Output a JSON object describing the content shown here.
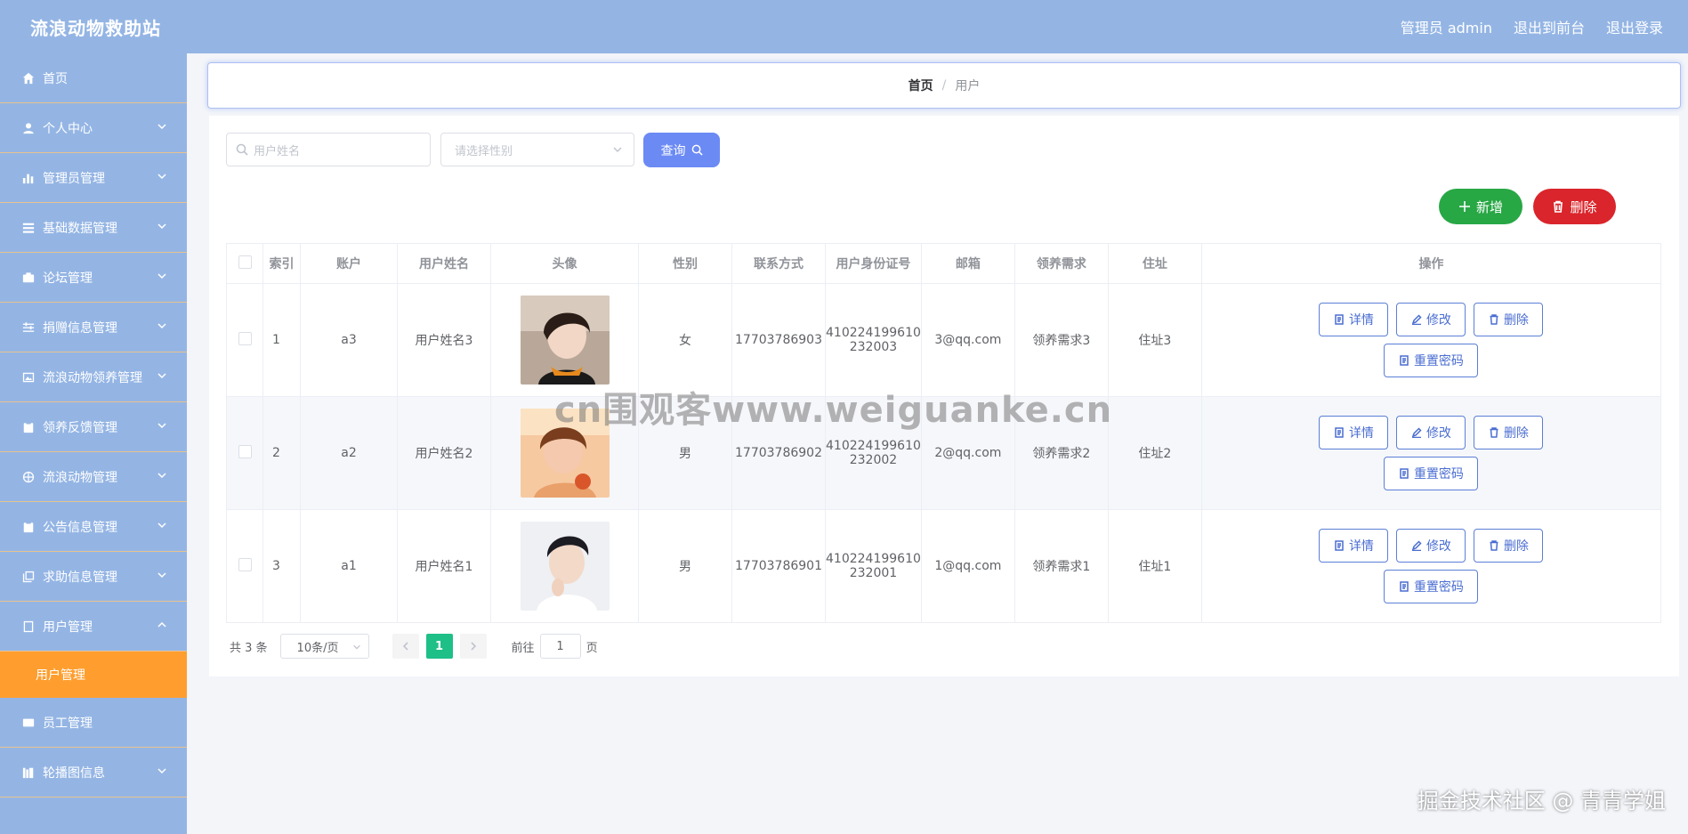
{
  "header": {
    "brand": "流浪动物救助站",
    "admin_label": "管理员 admin",
    "front_label": "退出到前台",
    "logout_label": "退出登录"
  },
  "sidebar": {
    "items": [
      {
        "label": "首页",
        "icon": "home-icon",
        "has_chevron": false
      },
      {
        "label": "个人中心",
        "icon": "user-icon",
        "has_chevron": true
      },
      {
        "label": "管理员管理",
        "icon": "bar-chart-icon",
        "has_chevron": true
      },
      {
        "label": "基础数据管理",
        "icon": "list-icon",
        "has_chevron": true
      },
      {
        "label": "论坛管理",
        "icon": "briefcase-icon",
        "has_chevron": true
      },
      {
        "label": "捐赠信息管理",
        "icon": "sliders-icon",
        "has_chevron": true
      },
      {
        "label": "流浪动物领养管理",
        "icon": "image-icon",
        "has_chevron": true
      },
      {
        "label": "领养反馈管理",
        "icon": "clipboard-icon",
        "has_chevron": true
      },
      {
        "label": "流浪动物管理",
        "icon": "globe-icon",
        "has_chevron": true
      },
      {
        "label": "公告信息管理",
        "icon": "clipboard-icon",
        "has_chevron": true
      },
      {
        "label": "求助信息管理",
        "icon": "copy-icon",
        "has_chevron": true
      },
      {
        "label": "用户管理",
        "icon": "document-icon",
        "has_chevron": true,
        "expanded": true
      }
    ],
    "active_sub": "用户管理",
    "items_after": [
      {
        "label": "员工管理",
        "icon": "card-icon",
        "has_chevron": false
      },
      {
        "label": "轮播图信息",
        "icon": "book-icon",
        "has_chevron": true
      }
    ]
  },
  "breadcrumb": {
    "home": "首页",
    "sep": "/",
    "current": "用户"
  },
  "search": {
    "name_placeholder": "用户姓名",
    "gender_placeholder": "请选择性别",
    "query_label": "查询"
  },
  "actions": {
    "add_label": "新增",
    "delete_label": "删除"
  },
  "table": {
    "columns": [
      "索引",
      "账户",
      "用户姓名",
      "头像",
      "性别",
      "联系方式",
      "用户身份证号",
      "邮箱",
      "领养需求",
      "住址",
      "操作"
    ],
    "rows": [
      {
        "index": "1",
        "account": "a3",
        "name": "用户姓名3",
        "gender": "女",
        "phone": "17703786903",
        "id_line1": "410224199610",
        "id_line2": "232003",
        "email": "3@qq.com",
        "need": "领养需求3",
        "address": "住址3"
      },
      {
        "index": "2",
        "account": "a2",
        "name": "用户姓名2",
        "gender": "男",
        "phone": "17703786902",
        "id_line1": "410224199610",
        "id_line2": "232002",
        "email": "2@qq.com",
        "need": "领养需求2",
        "address": "住址2"
      },
      {
        "index": "3",
        "account": "a1",
        "name": "用户姓名1",
        "gender": "男",
        "phone": "17703786901",
        "id_line1": "410224199610",
        "id_line2": "232001",
        "email": "1@qq.com",
        "need": "领养需求1",
        "address": "住址1"
      }
    ],
    "op_labels": {
      "detail": "详情",
      "edit": "修改",
      "delete": "删除",
      "reset": "重置密码"
    }
  },
  "pagination": {
    "total": "共 3 条",
    "page_size": "10条/页",
    "current_page": "1",
    "goto_prefix": "前往",
    "goto_value": "1",
    "goto_suffix": "页"
  },
  "overlay": {
    "watermark": "cn围观客www.weiguanke.cn",
    "footer": "掘金技术社区 @ 青青学姐"
  },
  "colors": {
    "header_bg": "#94b5e4",
    "active_menu": "#ff9e2e",
    "query_btn": "#6b8af4",
    "add_btn": "#28a745",
    "delete_btn": "#d9252b",
    "page_active": "#1fbf88"
  }
}
